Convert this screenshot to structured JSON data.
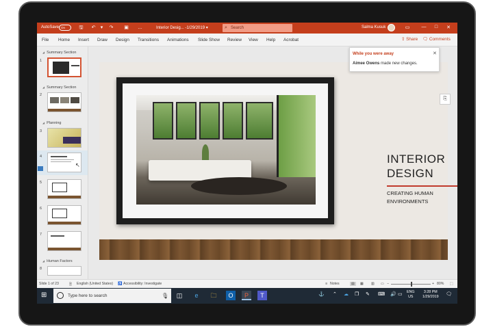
{
  "titlebar": {
    "autosave_label": "AutoSave",
    "autosave_state": "On",
    "doc_title": "Interior Desig... -1/29/2019 ▾",
    "search_placeholder": "Search",
    "user_name": "Salma Kusuk",
    "controls": {
      "minimize": "—",
      "restore": "□",
      "close": "✕"
    },
    "accent_color": "#c43e1c"
  },
  "ribbon": {
    "tabs": [
      "File",
      "Home",
      "Insert",
      "Draw",
      "Design",
      "Transitions",
      "Animations",
      "Slide Show",
      "Review",
      "View",
      "Help",
      "Acrobat"
    ],
    "share_label": "Share",
    "comments_label": "Comments"
  },
  "thumbnails": {
    "sections": [
      "Summary Section",
      "Summary Section",
      "Planning",
      "Human Factors"
    ],
    "slide_numbers": [
      "1",
      "2",
      "3",
      "4",
      "5",
      "6",
      "7",
      "8"
    ],
    "selected_slide": 1
  },
  "notification": {
    "title": "While you were away",
    "author": "Aimee Owens",
    "message": " made new changes.",
    "close": "✕"
  },
  "slide": {
    "title": "INTERIOR\nDESIGN",
    "subtitle": "CREATING HUMAN\nENVIRONMENTS",
    "rule_color": "#c0392b"
  },
  "statusbar": {
    "slide_info": "Slide 1 of 23",
    "language": "English (United States)",
    "accessibility": "Accessibility: Investigate",
    "notes": "Notes",
    "zoom_level": "80%",
    "zoom_fraction": 0.8
  },
  "taskbar": {
    "search_placeholder": "Type here to search",
    "lang_line1": "ENG",
    "lang_line2": "US",
    "time": "3:28 PM",
    "date": "1/29/2019"
  }
}
